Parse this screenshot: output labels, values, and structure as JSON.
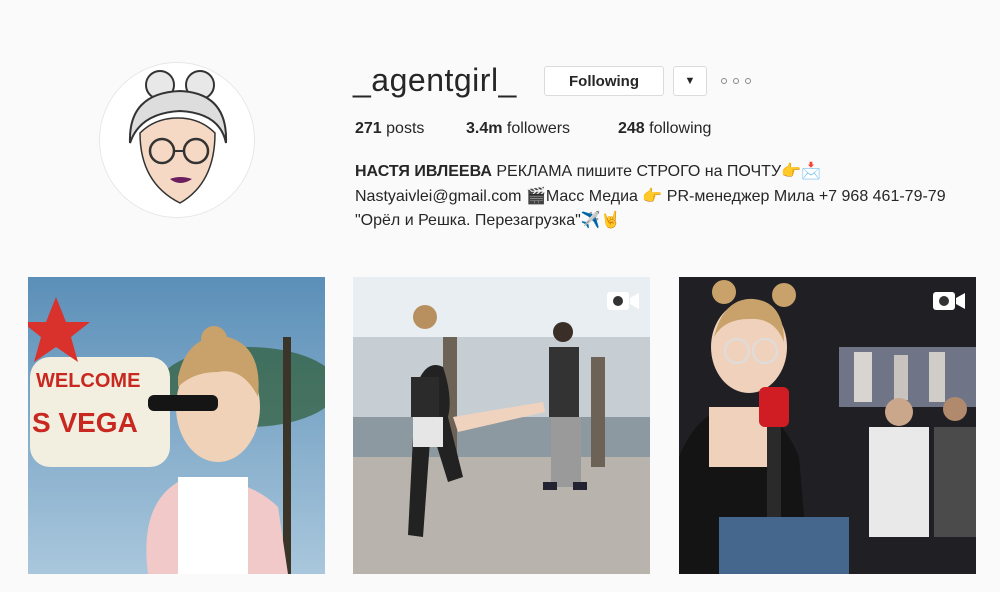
{
  "profile": {
    "username": "_agentgirl_",
    "follow_label": "Following",
    "dropdown_icon": "caret-down-icon",
    "more_icon": "ellipsis-icon"
  },
  "stats": {
    "posts_value": "271",
    "posts_label": "posts",
    "followers_value": "3.4m",
    "followers_label": "followers",
    "following_value": "248",
    "following_label": "following"
  },
  "bio": {
    "name": "НАСТЯ ИВЛЕЕВА",
    "line1_rest": "РЕКЛАМА пишите СТРОГО на ПОЧТУ👉📩",
    "line2": "Nastyaivlei@gmail.com 🎬Масс Медиа 👉 PR-менеджер Мила +7 968 461-79-79",
    "line3": "\"Орёл и Решка. Перезагрузка\"✈️🤘"
  },
  "posts": [
    {
      "type": "photo"
    },
    {
      "type": "video",
      "icon": "video-camera-icon"
    },
    {
      "type": "video",
      "icon": "video-camera-icon"
    }
  ]
}
